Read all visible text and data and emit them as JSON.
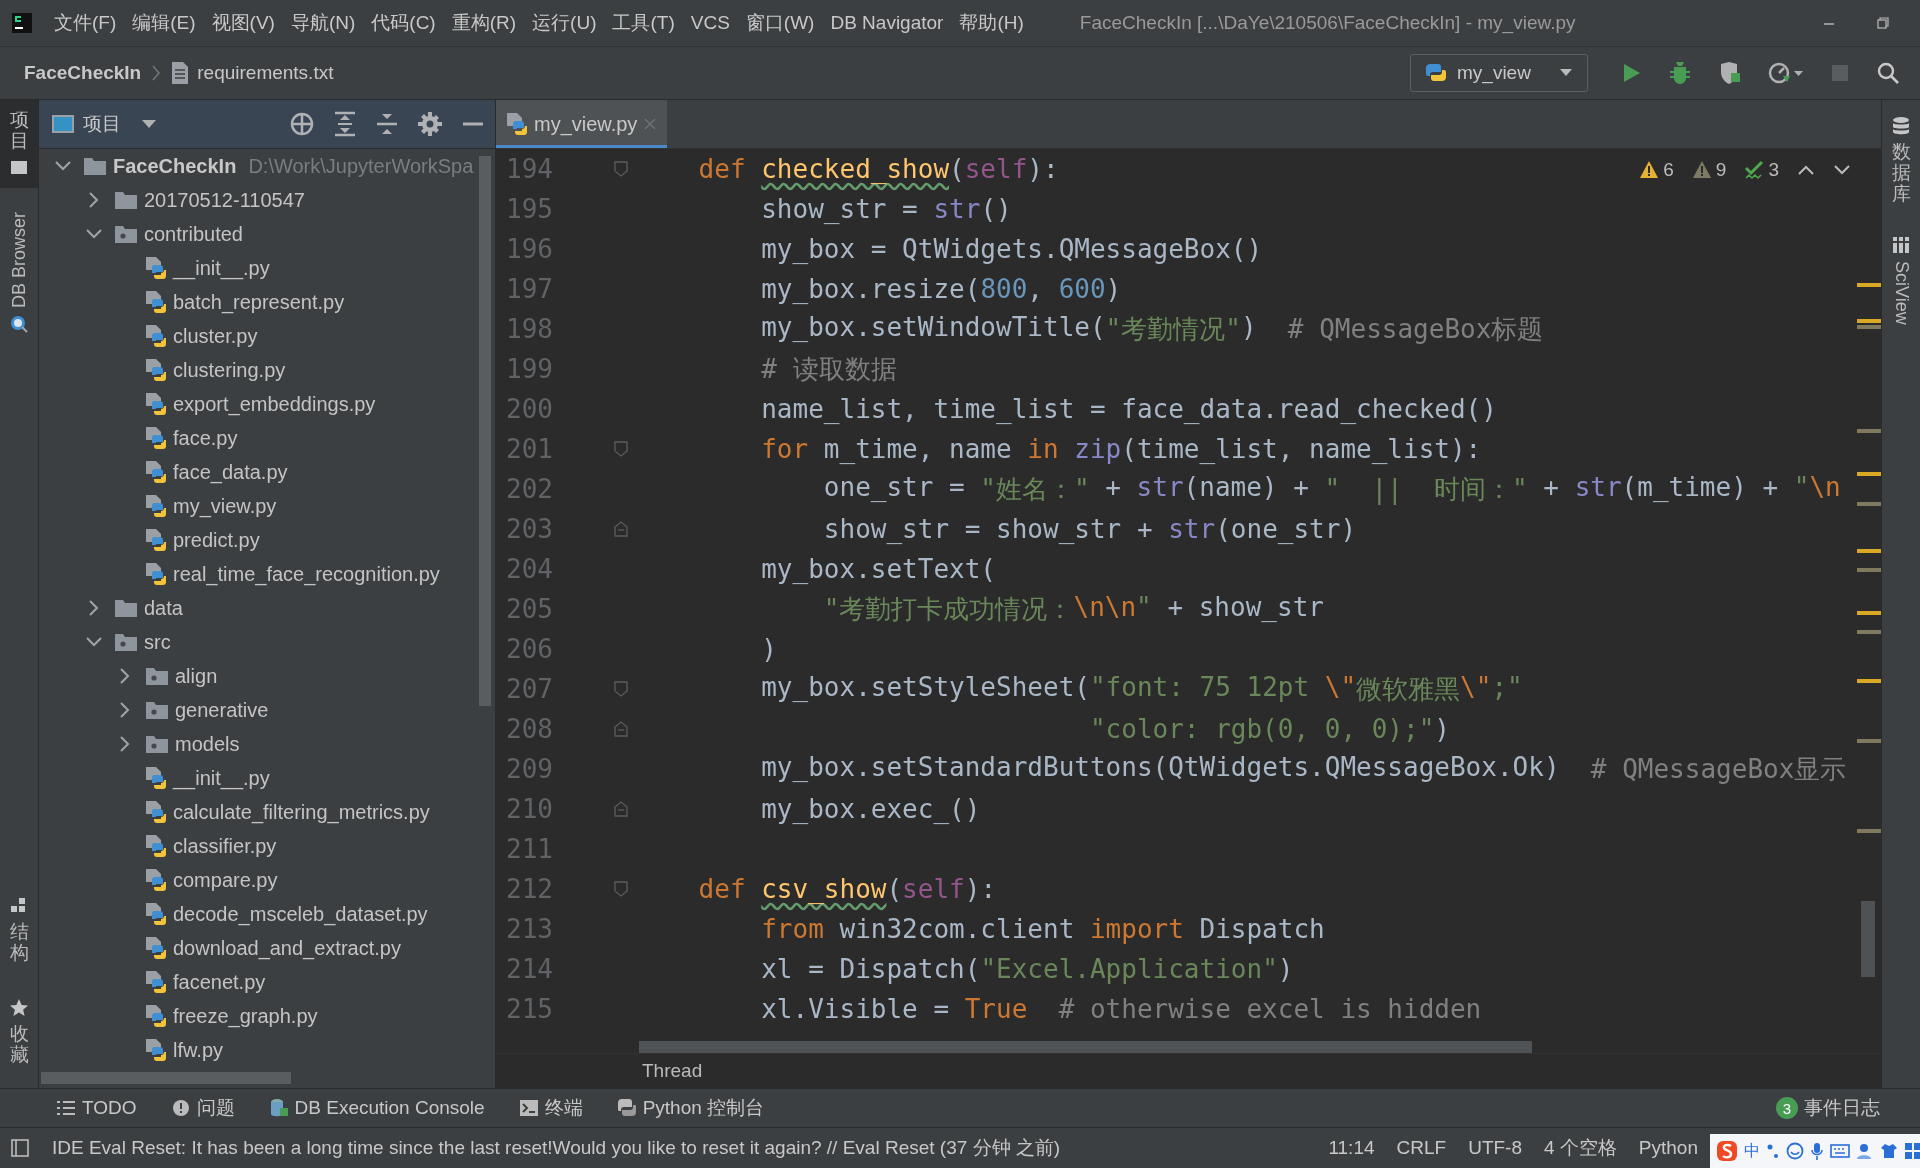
{
  "menu_bar": {
    "items": [
      "文件(F)",
      "编辑(E)",
      "视图(V)",
      "导航(N)",
      "代码(C)",
      "重构(R)",
      "运行(U)",
      "工具(T)",
      "VCS",
      "窗口(W)",
      "DB Navigator",
      "帮助(H)"
    ],
    "title": "FaceCheckIn [...\\DaYe\\210506\\FaceCheckIn] - my_view.py"
  },
  "nav_bar": {
    "breadcrumbs": [
      {
        "kind": "project",
        "label": "FaceCheckIn"
      },
      {
        "kind": "text_file",
        "label": "requirements.txt"
      }
    ],
    "run_config": "my_view"
  },
  "left_strip": {
    "top": [
      {
        "label": "项目",
        "kind": "cjk",
        "selected": true
      },
      {
        "label": "DB Browser",
        "kind": "latin",
        "selected": false
      }
    ],
    "bottom": [
      {
        "label": "结构",
        "kind": "cjk",
        "selected": false
      },
      {
        "label": "收藏",
        "kind": "cjk",
        "selected": false
      }
    ]
  },
  "project_panel": {
    "title": "项目",
    "tree": [
      {
        "kind": "folder",
        "label": "FaceCheckIn",
        "path": "D:\\Work\\JupyterWorkSpa",
        "expanded": true,
        "children": [
          {
            "kind": "folder",
            "label": "20170512-110547",
            "expanded": false
          },
          {
            "kind": "package",
            "label": "contributed",
            "expanded": true,
            "children": [
              {
                "kind": "python_file",
                "label": "__init__.py"
              },
              {
                "kind": "python_file",
                "label": "batch_represent.py"
              },
              {
                "kind": "python_file",
                "label": "cluster.py"
              },
              {
                "kind": "python_file",
                "label": "clustering.py"
              },
              {
                "kind": "python_file",
                "label": "export_embeddings.py"
              },
              {
                "kind": "python_file",
                "label": "face.py"
              },
              {
                "kind": "python_file",
                "label": "face_data.py"
              },
              {
                "kind": "python_file",
                "label": "my_view.py"
              },
              {
                "kind": "python_file",
                "label": "predict.py"
              },
              {
                "kind": "python_file",
                "label": "real_time_face_recognition.py"
              }
            ]
          },
          {
            "kind": "folder",
            "label": "data",
            "expanded": false
          },
          {
            "kind": "package",
            "label": "src",
            "expanded": true,
            "children": [
              {
                "kind": "package",
                "label": "align",
                "expanded": false
              },
              {
                "kind": "package",
                "label": "generative",
                "expanded": false
              },
              {
                "kind": "package",
                "label": "models",
                "expanded": false
              },
              {
                "kind": "python_file",
                "label": "__init__.py"
              },
              {
                "kind": "python_file",
                "label": "calculate_filtering_metrics.py"
              },
              {
                "kind": "python_file",
                "label": "classifier.py"
              },
              {
                "kind": "python_file",
                "label": "compare.py"
              },
              {
                "kind": "python_file",
                "label": "decode_msceleb_dataset.py"
              },
              {
                "kind": "python_file",
                "label": "download_and_extract.py"
              },
              {
                "kind": "python_file",
                "label": "facenet.py"
              },
              {
                "kind": "python_file",
                "label": "freeze_graph.py"
              },
              {
                "kind": "python_file",
                "label": "lfw.py"
              }
            ]
          }
        ]
      }
    ]
  },
  "editor": {
    "tabs": [
      {
        "label": "my_view.py",
        "selected": true
      }
    ],
    "inspections": [
      {
        "kind": "warning",
        "count": "6"
      },
      {
        "kind": "weak_warning",
        "count": "9"
      },
      {
        "kind": "typo",
        "count": "3"
      }
    ],
    "lines": [
      {
        "number": "194",
        "fold_start": true,
        "fold_end": false,
        "tokens": [
          {
            "kind": "keyword",
            "text": "    def "
          },
          {
            "kind": "function",
            "text": "checked_show",
            "typo": true
          },
          {
            "kind": "plain",
            "text": "("
          },
          {
            "kind": "self",
            "text": "self"
          },
          {
            "kind": "plain",
            "text": "):"
          }
        ]
      },
      {
        "number": "195",
        "fold_start": false,
        "fold_end": false,
        "tokens": [
          {
            "kind": "plain",
            "text": "        show_str = "
          },
          {
            "kind": "builtin",
            "text": "str"
          },
          {
            "kind": "plain",
            "text": "()"
          }
        ]
      },
      {
        "number": "196",
        "fold_start": false,
        "fold_end": false,
        "tokens": [
          {
            "kind": "plain",
            "text": "        my_box = QtWidgets.QMessageBox()"
          }
        ]
      },
      {
        "number": "197",
        "fold_start": false,
        "fold_end": false,
        "tokens": [
          {
            "kind": "plain",
            "text": "        my_box.resize("
          },
          {
            "kind": "number",
            "text": "800"
          },
          {
            "kind": "plain",
            "text": ", "
          },
          {
            "kind": "number",
            "text": "600"
          },
          {
            "kind": "plain",
            "text": ")"
          }
        ]
      },
      {
        "number": "198",
        "fold_start": false,
        "fold_end": false,
        "tokens": [
          {
            "kind": "plain",
            "text": "        my_box.setWindowTitle("
          },
          {
            "kind": "string",
            "text": "\"考勤情况\""
          },
          {
            "kind": "plain",
            "text": ")  "
          },
          {
            "kind": "comment",
            "text": "# QMessageBox标题"
          }
        ]
      },
      {
        "number": "199",
        "fold_start": false,
        "fold_end": false,
        "tokens": [
          {
            "kind": "comment",
            "text": "        # 读取数据"
          }
        ]
      },
      {
        "number": "200",
        "fold_start": false,
        "fold_end": false,
        "tokens": [
          {
            "kind": "plain",
            "text": "        name_list, time_list = face_data.read_checked()"
          }
        ]
      },
      {
        "number": "201",
        "fold_start": true,
        "fold_end": false,
        "tokens": [
          {
            "kind": "keyword",
            "text": "        for"
          },
          {
            "kind": "plain",
            "text": " m_time, name "
          },
          {
            "kind": "keyword",
            "text": "in "
          },
          {
            "kind": "builtin",
            "text": "zip"
          },
          {
            "kind": "plain",
            "text": "(time_list, name_list):"
          }
        ]
      },
      {
        "number": "202",
        "fold_start": false,
        "fold_end": false,
        "tokens": [
          {
            "kind": "plain",
            "text": "            one_str = "
          },
          {
            "kind": "string",
            "text": "\"姓名：\""
          },
          {
            "kind": "plain",
            "text": " + "
          },
          {
            "kind": "builtin",
            "text": "str"
          },
          {
            "kind": "plain",
            "text": "(name) + "
          },
          {
            "kind": "string",
            "text": "\"  ||  时间：\""
          },
          {
            "kind": "plain",
            "text": " + "
          },
          {
            "kind": "builtin",
            "text": "str"
          },
          {
            "kind": "plain",
            "text": "(m_time) + "
          },
          {
            "kind": "string",
            "text": "\""
          },
          {
            "kind": "escape",
            "text": "\\n"
          }
        ]
      },
      {
        "number": "203",
        "fold_start": false,
        "fold_end": true,
        "tokens": [
          {
            "kind": "plain",
            "text": "            show_str = show_str + "
          },
          {
            "kind": "builtin",
            "text": "str"
          },
          {
            "kind": "plain",
            "text": "(one_str)"
          }
        ]
      },
      {
        "number": "204",
        "fold_start": false,
        "fold_end": false,
        "tokens": [
          {
            "kind": "plain",
            "text": "        my_box.setText("
          }
        ]
      },
      {
        "number": "205",
        "fold_start": false,
        "fold_end": false,
        "tokens": [
          {
            "kind": "string",
            "text": "            \"考勤打卡成功情况："
          },
          {
            "kind": "escape",
            "text": "\\n\\n"
          },
          {
            "kind": "string",
            "text": "\""
          },
          {
            "kind": "plain",
            "text": " + show_str"
          }
        ]
      },
      {
        "number": "206",
        "fold_start": false,
        "fold_end": false,
        "tokens": [
          {
            "kind": "plain",
            "text": "        )"
          }
        ]
      },
      {
        "number": "207",
        "fold_start": true,
        "fold_end": false,
        "tokens": [
          {
            "kind": "plain",
            "text": "        my_box.setStyleSheet("
          },
          {
            "kind": "string",
            "text": "\"font: 75 12pt "
          },
          {
            "kind": "escape",
            "text": "\\\""
          },
          {
            "kind": "string",
            "text": "微软雅黑"
          },
          {
            "kind": "escape",
            "text": "\\\""
          },
          {
            "kind": "string",
            "text": ";\""
          }
        ]
      },
      {
        "number": "208",
        "fold_start": false,
        "fold_end": true,
        "tokens": [
          {
            "kind": "string",
            "text": "                             \"color: rgb(0, 0, 0);\""
          },
          {
            "kind": "plain",
            "text": ")"
          }
        ]
      },
      {
        "number": "209",
        "fold_start": false,
        "fold_end": false,
        "tokens": [
          {
            "kind": "plain",
            "text": "        my_box.setStandardButtons(QtWidgets.QMessageBox.Ok)  "
          },
          {
            "kind": "comment",
            "text": "# QMessageBox显示"
          }
        ]
      },
      {
        "number": "210",
        "fold_start": false,
        "fold_end": true,
        "tokens": [
          {
            "kind": "plain",
            "text": "        my_box.exec_()"
          }
        ]
      },
      {
        "number": "211",
        "fold_start": false,
        "fold_end": false
      },
      {
        "number": "212",
        "fold_start": true,
        "fold_end": false,
        "tokens": [
          {
            "kind": "keyword",
            "text": "    def "
          },
          {
            "kind": "function",
            "text": "csv_show",
            "typo": true
          },
          {
            "kind": "plain",
            "text": "("
          },
          {
            "kind": "self",
            "text": "self"
          },
          {
            "kind": "plain",
            "text": "):"
          }
        ]
      },
      {
        "number": "213",
        "fold_start": false,
        "fold_end": false,
        "tokens": [
          {
            "kind": "keyword",
            "text": "        from"
          },
          {
            "kind": "plain",
            "text": " win32com.client "
          },
          {
            "kind": "keyword",
            "text": "import"
          },
          {
            "kind": "plain",
            "text": " Dispatch"
          }
        ]
      },
      {
        "number": "214",
        "fold_start": false,
        "fold_end": false,
        "tokens": [
          {
            "kind": "plain",
            "text": "        xl = Dispatch("
          },
          {
            "kind": "string",
            "text": "\"Excel.Application\""
          },
          {
            "kind": "plain",
            "text": ")"
          }
        ]
      },
      {
        "number": "215",
        "fold_start": false,
        "fold_end": false,
        "tokens": [
          {
            "kind": "plain",
            "text": "        xl.Visible = "
          },
          {
            "kind": "keyword",
            "text": "True"
          },
          {
            "kind": "comment",
            "text": "  # otherwise excel is hidden"
          }
        ]
      }
    ],
    "breadcrumb": "Thread"
  },
  "right_strip": [
    {
      "label": "数据库",
      "kind": "cjk"
    },
    {
      "label": "SciView",
      "kind": "latin"
    }
  ],
  "tool_tabs": [
    {
      "label": "TODO"
    },
    {
      "label": "问题"
    },
    {
      "label": "DB Execution Console"
    },
    {
      "label": "终端"
    },
    {
      "label": "Python 控制台"
    }
  ],
  "event_log": {
    "count": "3",
    "label": "事件日志"
  },
  "status_bar": {
    "message": "IDE Eval Reset: It has been a long time since the last reset!Would you like to reset it again? // Eval Reset (37 分钟 之前)",
    "items": [
      "11:14",
      "CRLF",
      "UTF-8",
      "4 个空格",
      "Python"
    ]
  },
  "ime": {
    "mode": "中"
  }
}
